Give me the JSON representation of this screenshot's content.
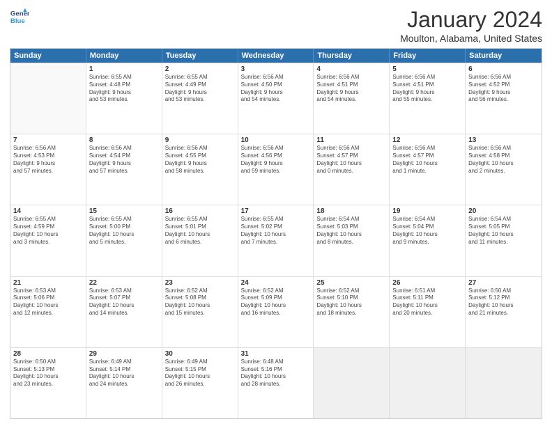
{
  "logo": {
    "line1": "General",
    "line2": "Blue"
  },
  "title": "January 2024",
  "location": "Moulton, Alabama, United States",
  "days_of_week": [
    "Sunday",
    "Monday",
    "Tuesday",
    "Wednesday",
    "Thursday",
    "Friday",
    "Saturday"
  ],
  "weeks": [
    [
      {
        "day": "",
        "text": ""
      },
      {
        "day": "1",
        "text": "Sunrise: 6:55 AM\nSunset: 4:48 PM\nDaylight: 9 hours\nand 53 minutes."
      },
      {
        "day": "2",
        "text": "Sunrise: 6:55 AM\nSunset: 4:49 PM\nDaylight: 9 hours\nand 53 minutes."
      },
      {
        "day": "3",
        "text": "Sunrise: 6:56 AM\nSunset: 4:50 PM\nDaylight: 9 hours\nand 54 minutes."
      },
      {
        "day": "4",
        "text": "Sunrise: 6:56 AM\nSunset: 4:51 PM\nDaylight: 9 hours\nand 54 minutes."
      },
      {
        "day": "5",
        "text": "Sunrise: 6:56 AM\nSunset: 4:51 PM\nDaylight: 9 hours\nand 55 minutes."
      },
      {
        "day": "6",
        "text": "Sunrise: 6:56 AM\nSunset: 4:52 PM\nDaylight: 9 hours\nand 56 minutes."
      }
    ],
    [
      {
        "day": "7",
        "text": "Sunrise: 6:56 AM\nSunset: 4:53 PM\nDaylight: 9 hours\nand 57 minutes."
      },
      {
        "day": "8",
        "text": "Sunrise: 6:56 AM\nSunset: 4:54 PM\nDaylight: 9 hours\nand 57 minutes."
      },
      {
        "day": "9",
        "text": "Sunrise: 6:56 AM\nSunset: 4:55 PM\nDaylight: 9 hours\nand 58 minutes."
      },
      {
        "day": "10",
        "text": "Sunrise: 6:56 AM\nSunset: 4:56 PM\nDaylight: 9 hours\nand 59 minutes."
      },
      {
        "day": "11",
        "text": "Sunrise: 6:56 AM\nSunset: 4:57 PM\nDaylight: 10 hours\nand 0 minutes."
      },
      {
        "day": "12",
        "text": "Sunrise: 6:56 AM\nSunset: 4:57 PM\nDaylight: 10 hours\nand 1 minute."
      },
      {
        "day": "13",
        "text": "Sunrise: 6:56 AM\nSunset: 4:58 PM\nDaylight: 10 hours\nand 2 minutes."
      }
    ],
    [
      {
        "day": "14",
        "text": "Sunrise: 6:55 AM\nSunset: 4:59 PM\nDaylight: 10 hours\nand 3 minutes."
      },
      {
        "day": "15",
        "text": "Sunrise: 6:55 AM\nSunset: 5:00 PM\nDaylight: 10 hours\nand 5 minutes."
      },
      {
        "day": "16",
        "text": "Sunrise: 6:55 AM\nSunset: 5:01 PM\nDaylight: 10 hours\nand 6 minutes."
      },
      {
        "day": "17",
        "text": "Sunrise: 6:55 AM\nSunset: 5:02 PM\nDaylight: 10 hours\nand 7 minutes."
      },
      {
        "day": "18",
        "text": "Sunrise: 6:54 AM\nSunset: 5:03 PM\nDaylight: 10 hours\nand 8 minutes."
      },
      {
        "day": "19",
        "text": "Sunrise: 6:54 AM\nSunset: 5:04 PM\nDaylight: 10 hours\nand 9 minutes."
      },
      {
        "day": "20",
        "text": "Sunrise: 6:54 AM\nSunset: 5:05 PM\nDaylight: 10 hours\nand 11 minutes."
      }
    ],
    [
      {
        "day": "21",
        "text": "Sunrise: 6:53 AM\nSunset: 5:06 PM\nDaylight: 10 hours\nand 12 minutes."
      },
      {
        "day": "22",
        "text": "Sunrise: 6:53 AM\nSunset: 5:07 PM\nDaylight: 10 hours\nand 14 minutes."
      },
      {
        "day": "23",
        "text": "Sunrise: 6:52 AM\nSunset: 5:08 PM\nDaylight: 10 hours\nand 15 minutes."
      },
      {
        "day": "24",
        "text": "Sunrise: 6:52 AM\nSunset: 5:09 PM\nDaylight: 10 hours\nand 16 minutes."
      },
      {
        "day": "25",
        "text": "Sunrise: 6:52 AM\nSunset: 5:10 PM\nDaylight: 10 hours\nand 18 minutes."
      },
      {
        "day": "26",
        "text": "Sunrise: 6:51 AM\nSunset: 5:11 PM\nDaylight: 10 hours\nand 20 minutes."
      },
      {
        "day": "27",
        "text": "Sunrise: 6:50 AM\nSunset: 5:12 PM\nDaylight: 10 hours\nand 21 minutes."
      }
    ],
    [
      {
        "day": "28",
        "text": "Sunrise: 6:50 AM\nSunset: 5:13 PM\nDaylight: 10 hours\nand 23 minutes."
      },
      {
        "day": "29",
        "text": "Sunrise: 6:49 AM\nSunset: 5:14 PM\nDaylight: 10 hours\nand 24 minutes."
      },
      {
        "day": "30",
        "text": "Sunrise: 6:49 AM\nSunset: 5:15 PM\nDaylight: 10 hours\nand 26 minutes."
      },
      {
        "day": "31",
        "text": "Sunrise: 6:48 AM\nSunset: 5:16 PM\nDaylight: 10 hours\nand 28 minutes."
      },
      {
        "day": "",
        "text": ""
      },
      {
        "day": "",
        "text": ""
      },
      {
        "day": "",
        "text": ""
      }
    ]
  ]
}
